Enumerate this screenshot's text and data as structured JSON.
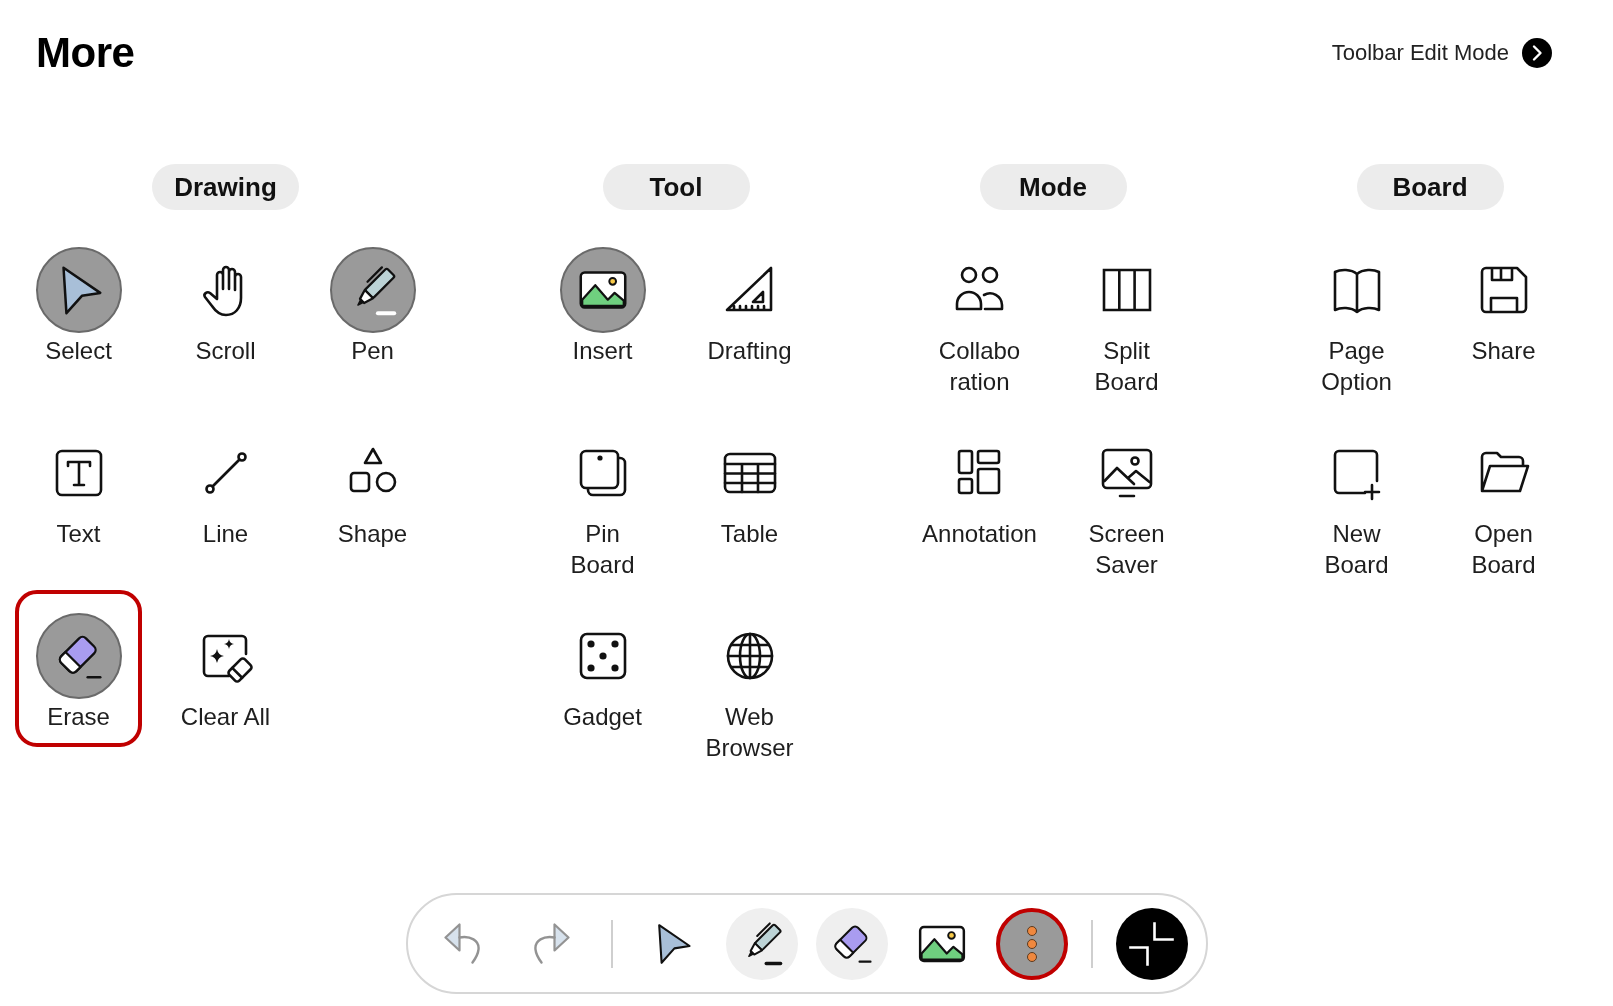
{
  "title": "More",
  "edit_mode_link": {
    "label": "Toolbar Edit Mode"
  },
  "groups": [
    {
      "heading": "Drawing",
      "items": [
        {
          "label": "Select",
          "in_toolbar": true,
          "highlighted": false
        },
        {
          "label": "Scroll",
          "in_toolbar": false,
          "highlighted": false
        },
        {
          "label": "Pen",
          "in_toolbar": true,
          "highlighted": false
        },
        {
          "label": "Text",
          "in_toolbar": false,
          "highlighted": false
        },
        {
          "label": "Line",
          "in_toolbar": false,
          "highlighted": false
        },
        {
          "label": "Shape",
          "in_toolbar": false,
          "highlighted": false
        },
        {
          "label": "Erase",
          "in_toolbar": true,
          "highlighted": true
        },
        {
          "label": "Clear All",
          "in_toolbar": false,
          "highlighted": false
        }
      ]
    },
    {
      "heading": "Tool",
      "items": [
        {
          "label": "Insert",
          "in_toolbar": true,
          "highlighted": false
        },
        {
          "label": "Drafting",
          "in_toolbar": false,
          "highlighted": false
        },
        {
          "label": "Pin\nBoard",
          "in_toolbar": false,
          "highlighted": false
        },
        {
          "label": "Table",
          "in_toolbar": false,
          "highlighted": false
        },
        {
          "label": "Gadget",
          "in_toolbar": false,
          "highlighted": false
        },
        {
          "label": "Web\nBrowser",
          "in_toolbar": false,
          "highlighted": false
        }
      ]
    },
    {
      "heading": "Mode",
      "items": [
        {
          "label": "Collabo\nration",
          "in_toolbar": false,
          "highlighted": false
        },
        {
          "label": "Split\nBoard",
          "in_toolbar": false,
          "highlighted": false
        },
        {
          "label": "Annotation",
          "in_toolbar": false,
          "highlighted": false
        },
        {
          "label": "Screen\nSaver",
          "in_toolbar": false,
          "highlighted": false
        }
      ]
    },
    {
      "heading": "Board",
      "items": [
        {
          "label": "Page\nOption",
          "in_toolbar": false,
          "highlighted": false
        },
        {
          "label": "Share",
          "in_toolbar": false,
          "highlighted": false
        },
        {
          "label": "New\nBoard",
          "in_toolbar": false,
          "highlighted": false
        },
        {
          "label": "Open\nBoard",
          "in_toolbar": false,
          "highlighted": false
        }
      ]
    }
  ],
  "toolbar": {
    "groups": [
      {
        "buttons": [
          {
            "kind": "icon",
            "disabled": true,
            "active": false,
            "open": false,
            "highlighted": false
          },
          {
            "kind": "icon",
            "disabled": true,
            "active": false,
            "open": false,
            "highlighted": false
          }
        ]
      },
      {
        "buttons": [
          {
            "kind": "icon",
            "disabled": false,
            "active": false,
            "open": false,
            "highlighted": false
          },
          {
            "kind": "icon",
            "disabled": false,
            "active": true,
            "open": false,
            "highlighted": false
          },
          {
            "kind": "icon",
            "disabled": false,
            "active": true,
            "open": false,
            "highlighted": false
          },
          {
            "kind": "icon",
            "disabled": false,
            "active": false,
            "open": false,
            "highlighted": false
          },
          {
            "kind": "icon",
            "disabled": false,
            "active": false,
            "open": true,
            "highlighted": true
          }
        ]
      },
      {
        "buttons": [
          {
            "kind": "filled",
            "disabled": false,
            "active": false,
            "open": false,
            "highlighted": false
          }
        ]
      }
    ]
  }
}
